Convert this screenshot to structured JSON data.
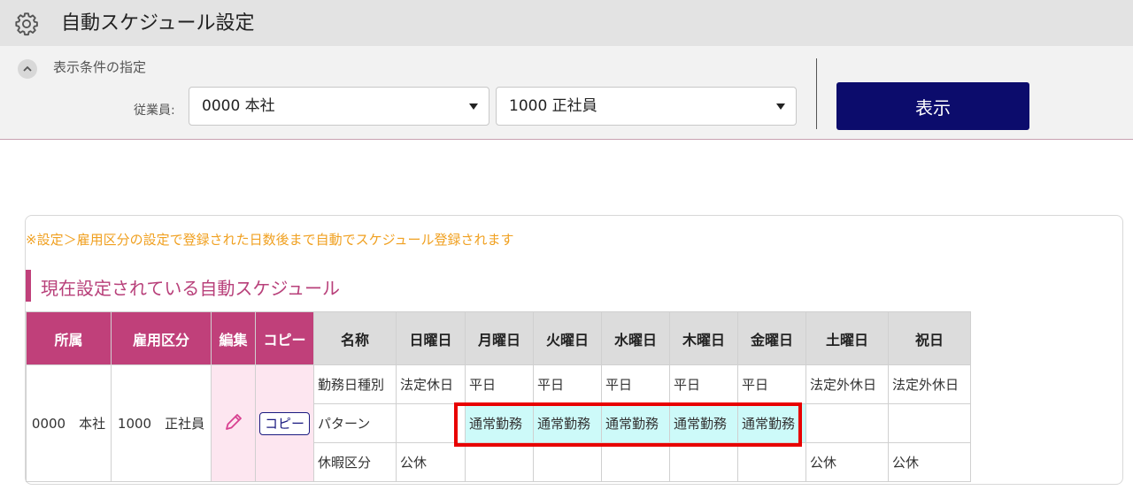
{
  "header": {
    "title": "自動スケジュール設定",
    "icon": "gear-icon"
  },
  "conditions": {
    "toggle_label": "表示条件の指定",
    "employee_label": "従業員:",
    "select1_value": "0000 本社",
    "select2_value": "1000 正社員",
    "show_button": "表示"
  },
  "notice": "※設定＞雇用区分の設定で登録された日数後まで自動でスケジュール登録されます",
  "section_title": "現在設定されている自動スケジュール",
  "table": {
    "headers": [
      "所属",
      "雇用区分",
      "編集",
      "コピー",
      "名称",
      "日曜日",
      "月曜日",
      "火曜日",
      "水曜日",
      "木曜日",
      "金曜日",
      "土曜日",
      "祝日"
    ],
    "row": {
      "affiliation": "0000　本社",
      "employment": "1000　正社員",
      "copy_button": "コピー"
    },
    "rows": [
      {
        "name": "勤務日種別",
        "cells": [
          "法定休日",
          "平日",
          "平日",
          "平日",
          "平日",
          "平日",
          "法定外休日",
          "法定外休日"
        ]
      },
      {
        "name": "パターン",
        "cells": [
          "",
          "通常勤務",
          "通常勤務",
          "通常勤務",
          "通常勤務",
          "通常勤務",
          "",
          ""
        ]
      },
      {
        "name": "休暇区分",
        "cells": [
          "公休",
          "",
          "",
          "",
          "",
          "",
          "公休",
          "公休"
        ]
      }
    ]
  },
  "colors": {
    "accent_pink": "#c0407a",
    "button_navy": "#0c0c6c",
    "highlight_red": "#e80000",
    "pattern_cyan": "#cdfaf9"
  }
}
